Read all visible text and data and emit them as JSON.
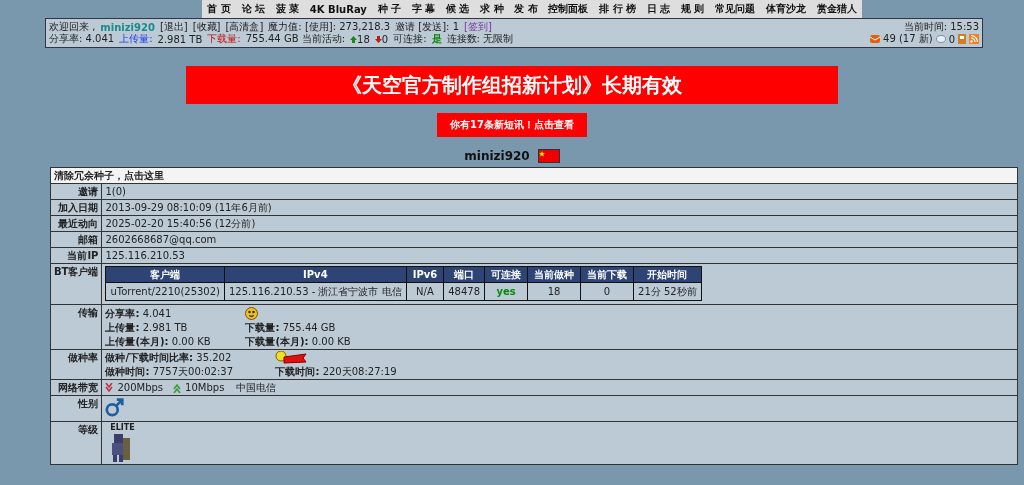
{
  "nav": [
    "首 页",
    "论 坛",
    "菠 菜",
    "4K BluRay",
    "种 子",
    "字 幕",
    "候 选",
    "求 种",
    "发 布",
    "控制面板",
    "排 行 榜",
    "日 志",
    "规 则",
    "常见问题",
    "体育沙龙",
    "赏金猎人"
  ],
  "info": {
    "line1": [
      {
        "kind": "text",
        "text": "欢迎回来 ,"
      },
      {
        "kind": "user",
        "text": "minizi920"
      },
      {
        "kind": "link",
        "text": "[退出]"
      },
      {
        "kind": "link",
        "text": "[收藏]"
      },
      {
        "kind": "link",
        "text": "[高清盒]"
      },
      {
        "kind": "text",
        "text": "魔力值: [使用]: 273,218.3"
      },
      {
        "kind": "text",
        "text": "邀请 [发送]: 1"
      },
      {
        "kind": "purple",
        "text": "[签到]"
      }
    ],
    "line2": [
      {
        "kind": "text",
        "text": "分享率:  4.041"
      },
      {
        "kind": "up_label",
        "text": "上传量:"
      },
      {
        "kind": "text",
        "text": "2.981 TB"
      },
      {
        "kind": "down_label",
        "text": "下载量:"
      },
      {
        "kind": "text",
        "text": "755.44 GB 当前活动:"
      },
      {
        "kind": "seed",
        "text": "18"
      },
      {
        "kind": "leech",
        "text": "0"
      },
      {
        "kind": "text",
        "text": "可连接:"
      },
      {
        "kind": "yes",
        "text": "是"
      },
      {
        "kind": "text",
        "text": "连接数: 无限制"
      }
    ],
    "time": "当前时间: 15:53",
    "messages": "49 (17 新)",
    "comments": "0"
  },
  "banner": "《天空官方制作组招新计划》长期有效",
  "notice_button": "你有17条新短讯！点击查看",
  "username": "minizi920",
  "table": {
    "header": "清除冗余种子，点击这里",
    "rows": [
      {
        "kind": "text",
        "label": "邀请",
        "value": "1(0)"
      },
      {
        "kind": "text",
        "label": "加入日期",
        "value": "2013-09-29 08:10:09 (11年6月前)"
      },
      {
        "kind": "text",
        "label": "最近动向",
        "value": "2025-02-20 15:40:56 (12分前)"
      },
      {
        "kind": "text",
        "label": "邮箱",
        "value": "2602668687@qq.com"
      },
      {
        "kind": "text",
        "label": "当前IP",
        "value": "125.116.210.53"
      },
      {
        "kind": "clients",
        "label": "BT客户端",
        "columns": [
          "客户端",
          "IPv4",
          "IPv6",
          "端口",
          "可连接",
          "当前做种",
          "当前下载",
          "开始时间"
        ],
        "cells": [
          "uTorrent/2210(25302)",
          "125.116.210.53 - 浙江省宁波市 电信",
          "N/A",
          "48478",
          "yes",
          "18",
          "0",
          "21分 52秒前"
        ]
      },
      {
        "kind": "transfer",
        "label": "传输",
        "pairs": [
          [
            "分享率:",
            "4.041"
          ],
          [
            "上传量:",
            "2.981 TB"
          ],
          [
            "下载量:",
            "755.44 GB"
          ],
          [
            "上传量(本月):",
            "0.00 KB"
          ],
          [
            "下载量(本月):",
            "0.00 KB"
          ]
        ]
      },
      {
        "kind": "seeding",
        "label": "做种率",
        "pairs": [
          [
            "做种/下载时间比率:",
            "35.202"
          ],
          [
            "做种时间:",
            "7757天00:02:37"
          ],
          [
            "下载时间:",
            "220天08:27:19"
          ]
        ]
      },
      {
        "kind": "bandwidth",
        "label": "网络带宽",
        "down": "200Mbps",
        "up": "10Mbps",
        "isp": "中国电信"
      },
      {
        "kind": "gender",
        "label": "性别"
      },
      {
        "kind": "level",
        "label": "等级",
        "badge": "ELITE"
      }
    ]
  }
}
